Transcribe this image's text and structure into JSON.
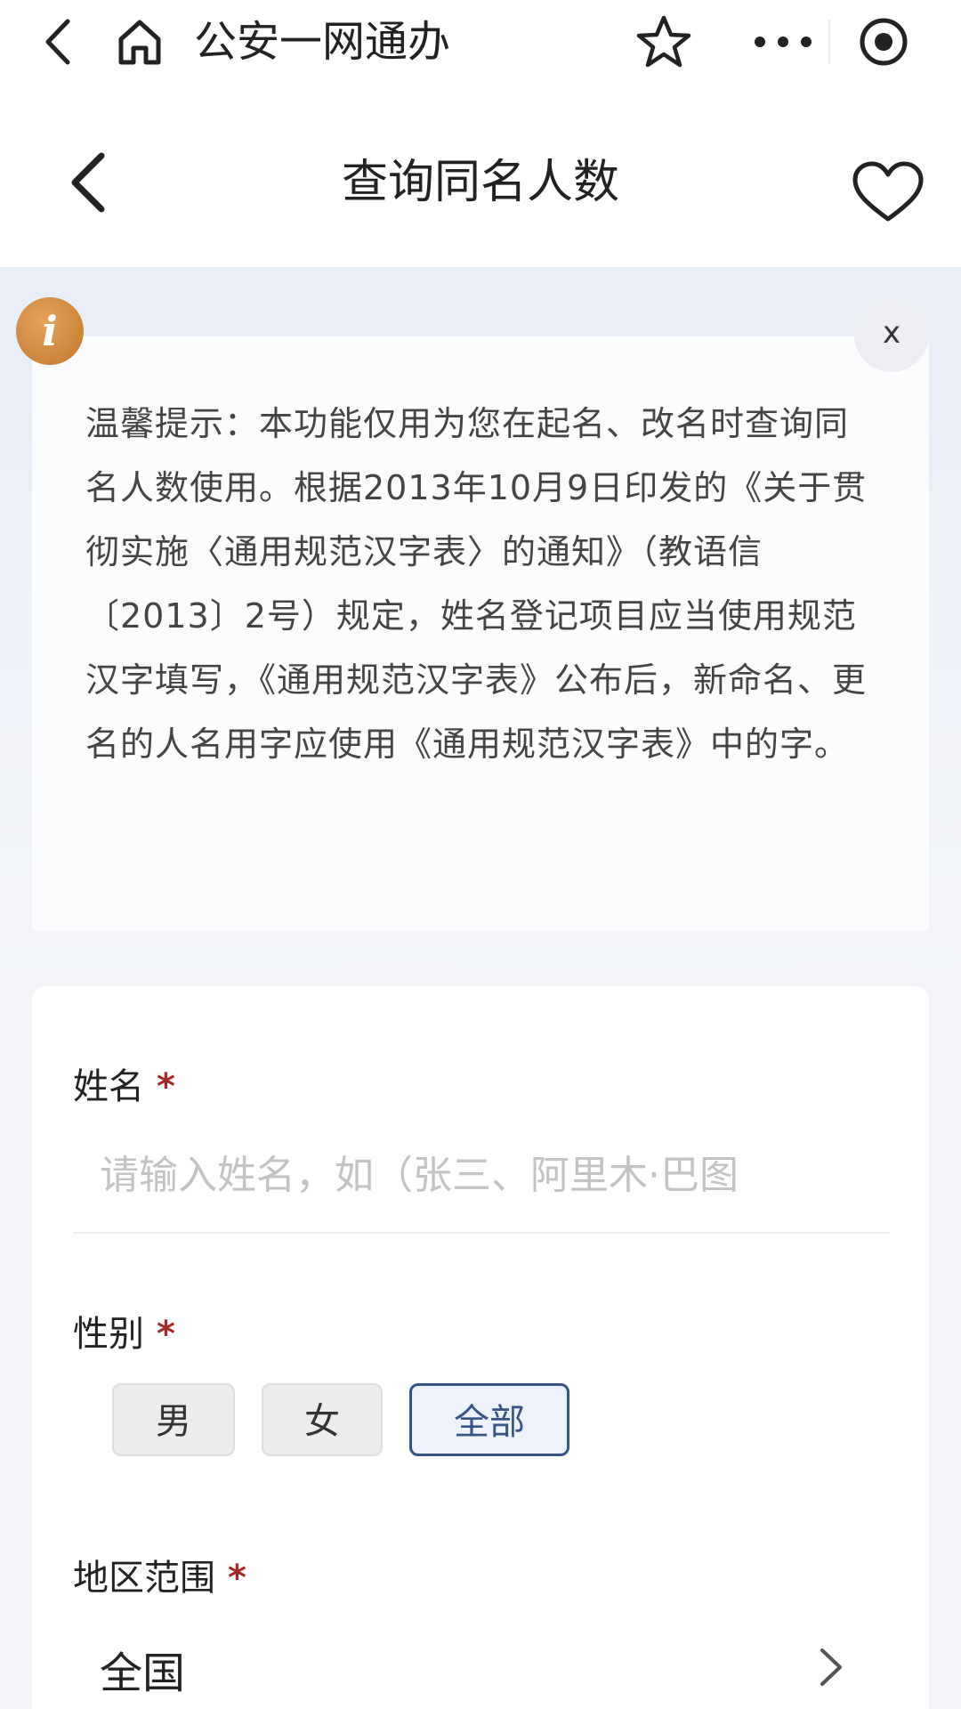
{
  "app_bar": {
    "title": "公安一网通办",
    "icons": [
      "back-arrow-icon",
      "home-icon",
      "star-icon",
      "more-dots-icon",
      "target-icon"
    ]
  },
  "nav": {
    "title": "查询同名人数",
    "icons": [
      "back-chevron-icon",
      "heart-icon"
    ]
  },
  "notice": {
    "badge": "i",
    "close_label": "x",
    "text": "温馨提示：本功能仅用为您在起名、改名时查询同名人数使用。根据2013年10月9日印发的《关于贯彻实施〈通用规范汉字表〉的通知》（教语信〔2013〕2号）规定，姓名登记项目应当使用规范汉字填写，《通用规范汉字表》公布后，新命名、更名的人名用字应使用《通用规范汉字表》中的字。"
  },
  "form": {
    "name": {
      "label": "姓名",
      "required_mark": "*",
      "value": "",
      "placeholder": "请输入姓名，如（张三、阿里木·巴图"
    },
    "gender": {
      "label": "性别",
      "required_mark": "*",
      "options": [
        "男",
        "女",
        "全部"
      ],
      "selected": "全部"
    },
    "region": {
      "label": "地区范围",
      "required_mark": "*",
      "value": "全国"
    }
  },
  "colors": {
    "accent": "#355586",
    "required": "#a52a2a",
    "info_badge": "#c98434"
  }
}
